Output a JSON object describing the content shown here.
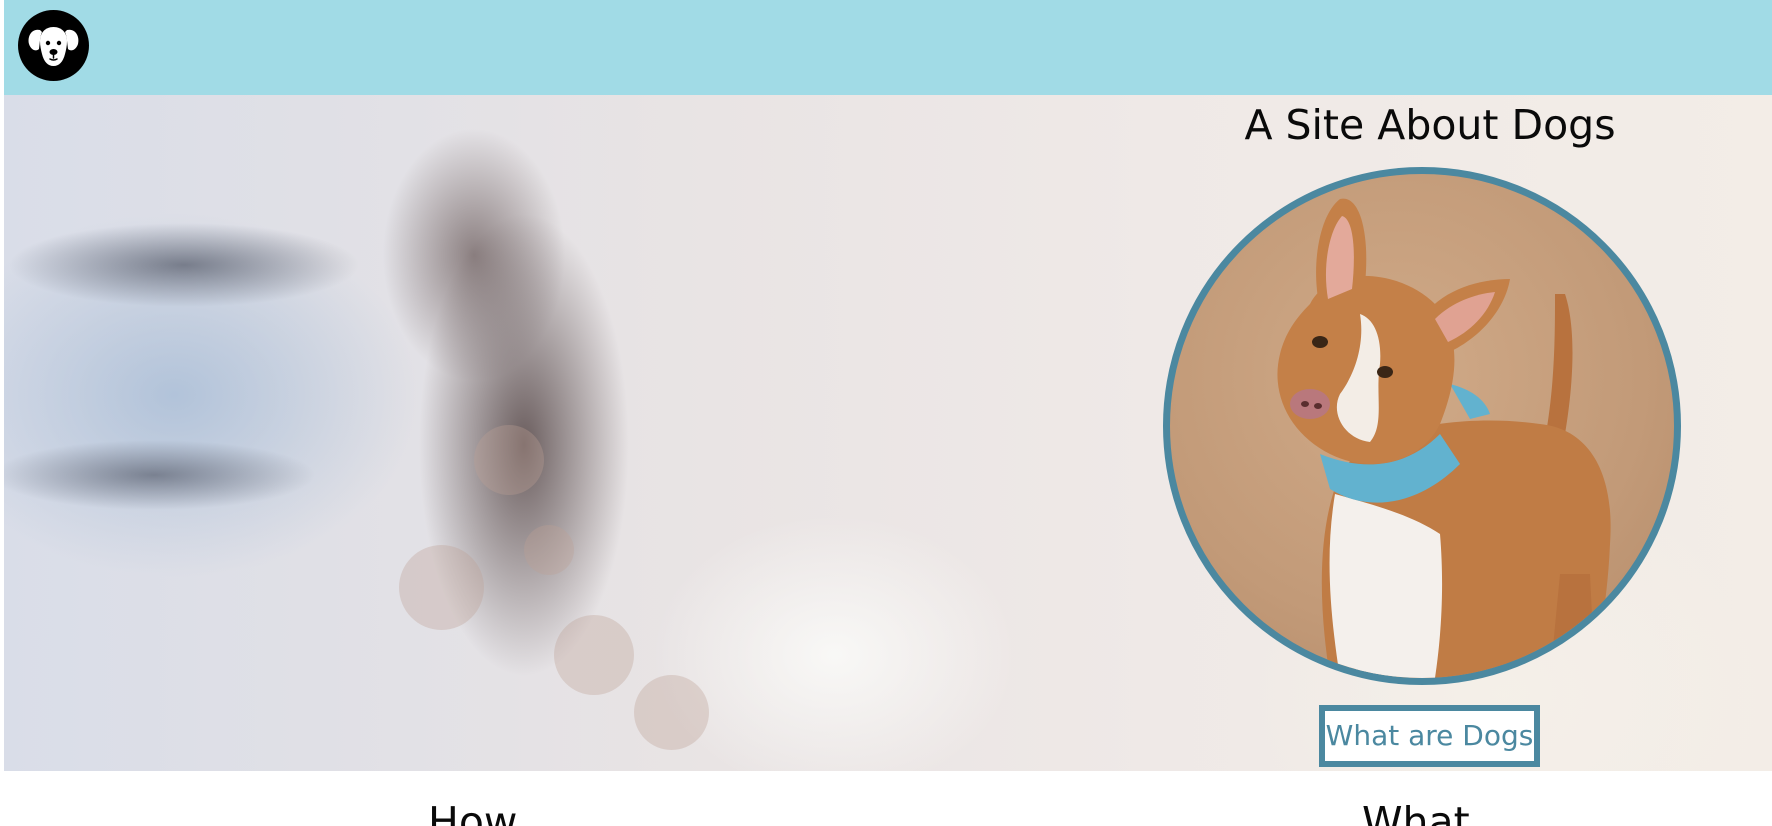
{
  "header": {
    "logo_icon": "dog-face-icon",
    "background_color": "#a1dbe6"
  },
  "hero": {
    "title": "A Site About Dogs",
    "photo_subject": "dog-photo",
    "cta_label": "What are Dogs",
    "accent_color": "#4b88a0"
  },
  "sections": {
    "how_heading": "How",
    "what_heading": "What"
  }
}
